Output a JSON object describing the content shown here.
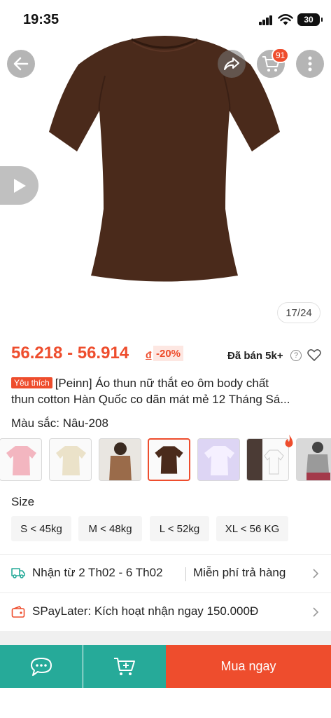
{
  "status_bar": {
    "time": "19:35",
    "battery": "30"
  },
  "gallery": {
    "counter": "17/24",
    "cart_count": "91"
  },
  "price": {
    "range": "56.218 - 56.914",
    "currency": "đ",
    "discount": "-20%",
    "sold": "Đã bán 5k+"
  },
  "product": {
    "badge": "Yêu thích",
    "title_line1": "[Peinn] Áo thun nữ thắt eo ôm body chất",
    "title_line2": "thun cotton Hàn Quốc co dãn mát mẻ 12 Tháng Sá..."
  },
  "color": {
    "label": "Màu sắc: Nâu-208"
  },
  "size": {
    "label": "Size",
    "options": [
      "S < 45kg",
      "M < 48kg",
      "L < 52kg",
      "XL < 56 KG"
    ]
  },
  "shipping": {
    "delivery": "Nhận từ 2 Th02 - 6 Th02",
    "returns": "Miễn phí trả hàng"
  },
  "paylater": {
    "text": "SPayLater: Kích hoạt nhận ngay 150.000Đ"
  },
  "actions": {
    "buy_now": "Mua ngay"
  },
  "colors": {
    "brand": "#ee4d2d",
    "teal": "#26aa99",
    "shirt": "#4a2a1b"
  }
}
